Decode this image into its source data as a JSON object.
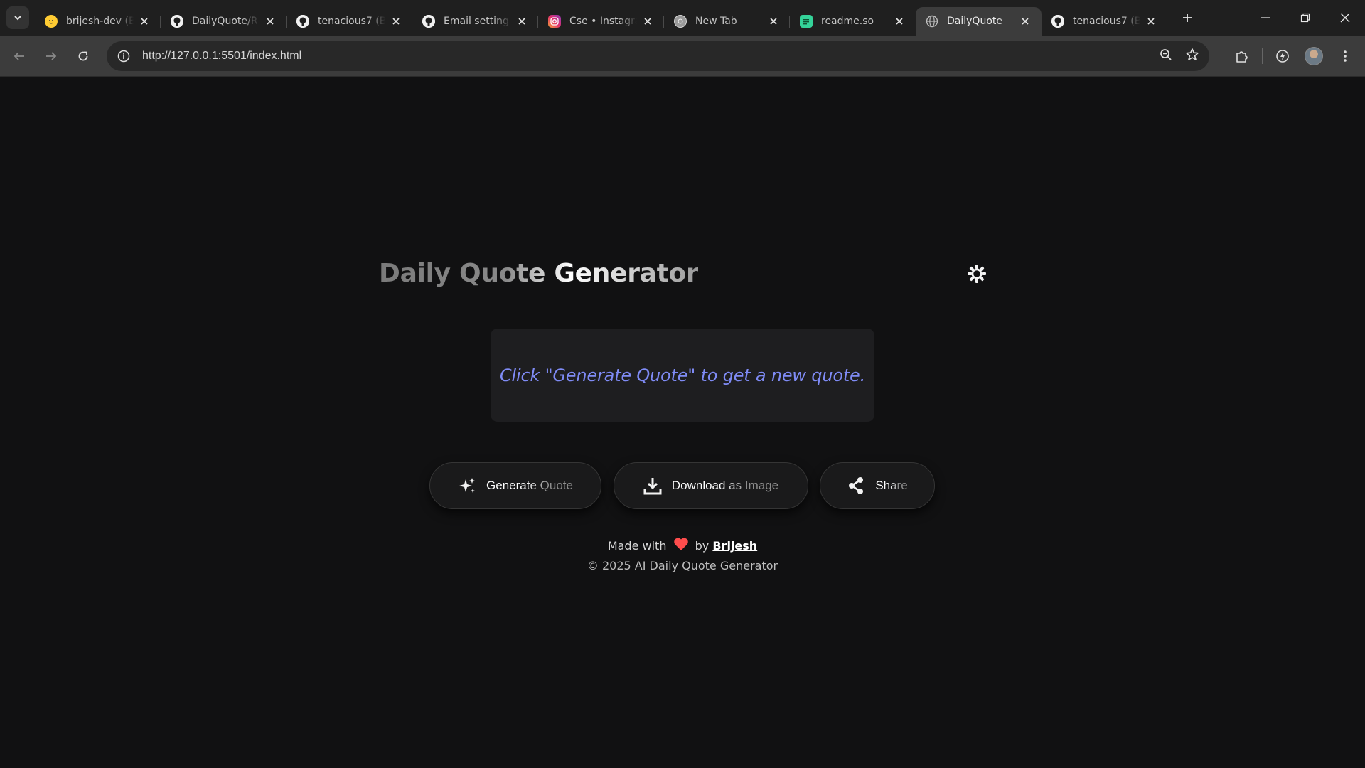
{
  "browser": {
    "tabs": [
      {
        "title": "brijesh-dev (B",
        "icon": "hugging-face-icon"
      },
      {
        "title": "DailyQuote/R",
        "icon": "github-icon"
      },
      {
        "title": "tenacious7 (B",
        "icon": "github-icon"
      },
      {
        "title": "Email setting",
        "icon": "github-icon"
      },
      {
        "title": "Cse • Instagra",
        "icon": "instagram-icon"
      },
      {
        "title": "New Tab",
        "icon": "chrome-icon"
      },
      {
        "title": "readme.so",
        "icon": "readme-icon"
      },
      {
        "title": "DailyQuote",
        "icon": "globe-icon",
        "active": true
      },
      {
        "title": "tenacious7 (B",
        "icon": "github-icon"
      }
    ],
    "url": "http://127.0.0.1:5501/index.html"
  },
  "page": {
    "title": "Daily Quote Generator",
    "quote_placeholder": "Click \"Generate Quote\" to get a new quote.",
    "buttons": {
      "generate": "Generate Quote",
      "download": "Download as Image",
      "share": "Share"
    },
    "footer": {
      "made_with": "Made with",
      "by": "by",
      "author": "Brijesh",
      "copyright": "© 2025 AI Daily Quote Generator"
    }
  },
  "colors": {
    "page_background": "#111112",
    "quote_text": "#7f8bf5",
    "heart": "#ff4d4d",
    "active_tab": "#3c3c3c"
  }
}
